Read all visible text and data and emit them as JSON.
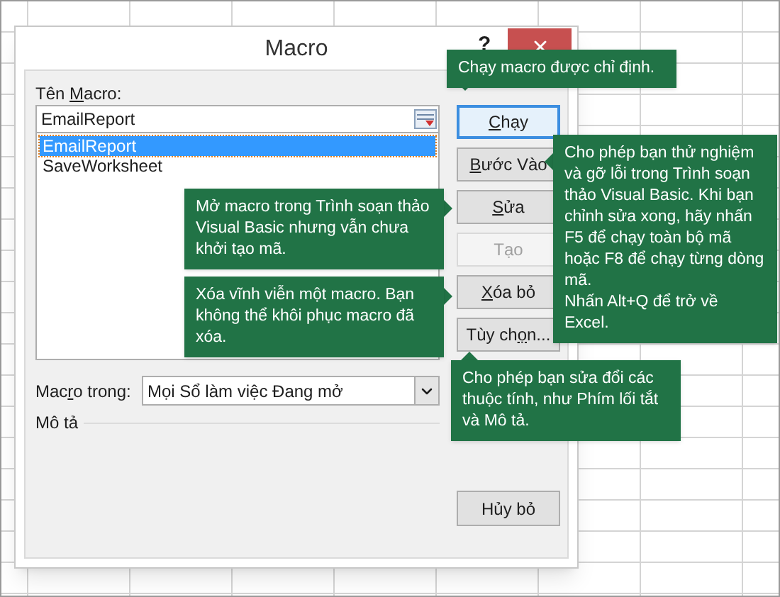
{
  "window": {
    "title": "Macro",
    "help": "?"
  },
  "macro_name": {
    "label": {
      "pre": "Tên ",
      "key": "M",
      "post": "acro:"
    },
    "value": "EmailReport"
  },
  "macros": [
    {
      "name": "EmailReport",
      "selected": true
    },
    {
      "name": "SaveWorksheet",
      "selected": false
    }
  ],
  "buttons": [
    {
      "label": {
        "key": "C",
        "post": "hạy"
      },
      "focused": true,
      "disabled": false
    },
    {
      "label": {
        "key": "B",
        "post": "ước Vào"
      },
      "focused": false,
      "disabled": false
    },
    {
      "label": {
        "key": "S",
        "post": "ửa"
      },
      "focused": false,
      "disabled": false
    },
    {
      "label": {
        "pre": "Tạo"
      },
      "focused": false,
      "disabled": true
    },
    {
      "label": {
        "key": "X",
        "post": "óa bỏ"
      },
      "focused": false,
      "disabled": false
    },
    {
      "label": {
        "pre": "Tùy ch",
        "key": "ọ",
        "post": "n..."
      },
      "focused": false,
      "disabled": false
    }
  ],
  "macros_in": {
    "label": {
      "pre": "Mac",
      "key": "r",
      "post": "o trong:"
    },
    "value": "Mọi Sổ làm việc Đang mở"
  },
  "description": {
    "label": "Mô tả"
  },
  "cancel_button": "Hủy bỏ",
  "callouts": [
    {
      "kind": "down",
      "paragraphs": [
        "Chạy macro được chỉ định."
      ]
    },
    {
      "kind": "left",
      "paragraphs": [
        "Cho phép bạn thử nghiệm và gỡ lỗi trong Trình soạn thảo Visual Basic. Khi bạn chỉnh sửa xong, hãy nhấn F5 để chạy toàn bộ mã hoặc F8 để chạy từng dòng mã.",
        "Nhấn Alt+Q để trở về Excel."
      ]
    },
    {
      "kind": "right",
      "paragraphs": [
        "Mở macro trong Trình soạn thảo Visual Basic nhưng vẫn chưa khởi tạo mã."
      ]
    },
    {
      "kind": "right",
      "paragraphs": [
        "Xóa vĩnh viễn một macro. Bạn không thể khôi phục macro đã xóa."
      ]
    },
    {
      "kind": "up",
      "paragraphs": [
        "Cho phép bạn sửa đổi các thuộc tính, như Phím lối tắt và Mô tả."
      ]
    }
  ]
}
